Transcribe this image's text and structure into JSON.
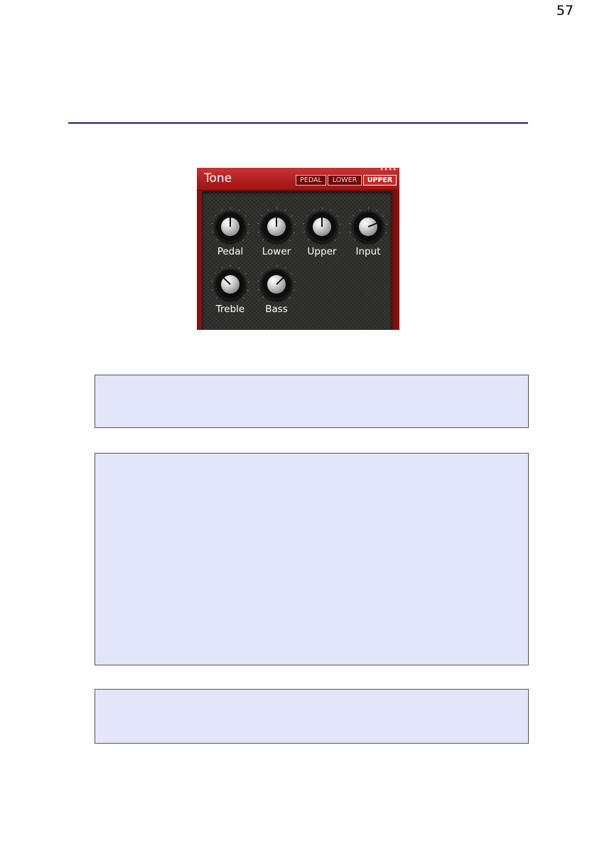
{
  "page": {
    "number": "57"
  },
  "tone_panel": {
    "title": "Tone",
    "tabs": [
      {
        "label": "PEDAL",
        "active": false
      },
      {
        "label": "LOWER",
        "active": false
      },
      {
        "label": "UPPER",
        "active": true
      }
    ],
    "knobs": [
      {
        "label": "Pedal",
        "value": 0.5
      },
      {
        "label": "Lower",
        "value": 0.5
      },
      {
        "label": "Upper",
        "value": 0.5
      },
      {
        "label": "Input",
        "value": 0.75
      },
      {
        "label": "Treble",
        "value": 0.33
      },
      {
        "label": "Bass",
        "value": 0.67
      }
    ],
    "colors": {
      "frame": "#8b1010",
      "header": "#b01f1f",
      "body": "#2b2b29"
    }
  },
  "note_boxes": [
    {
      "text": ""
    },
    {
      "text": ""
    },
    {
      "text": ""
    }
  ],
  "colors": {
    "rule": "#1a1f78",
    "note_box_bg": "#e3e5fa"
  }
}
